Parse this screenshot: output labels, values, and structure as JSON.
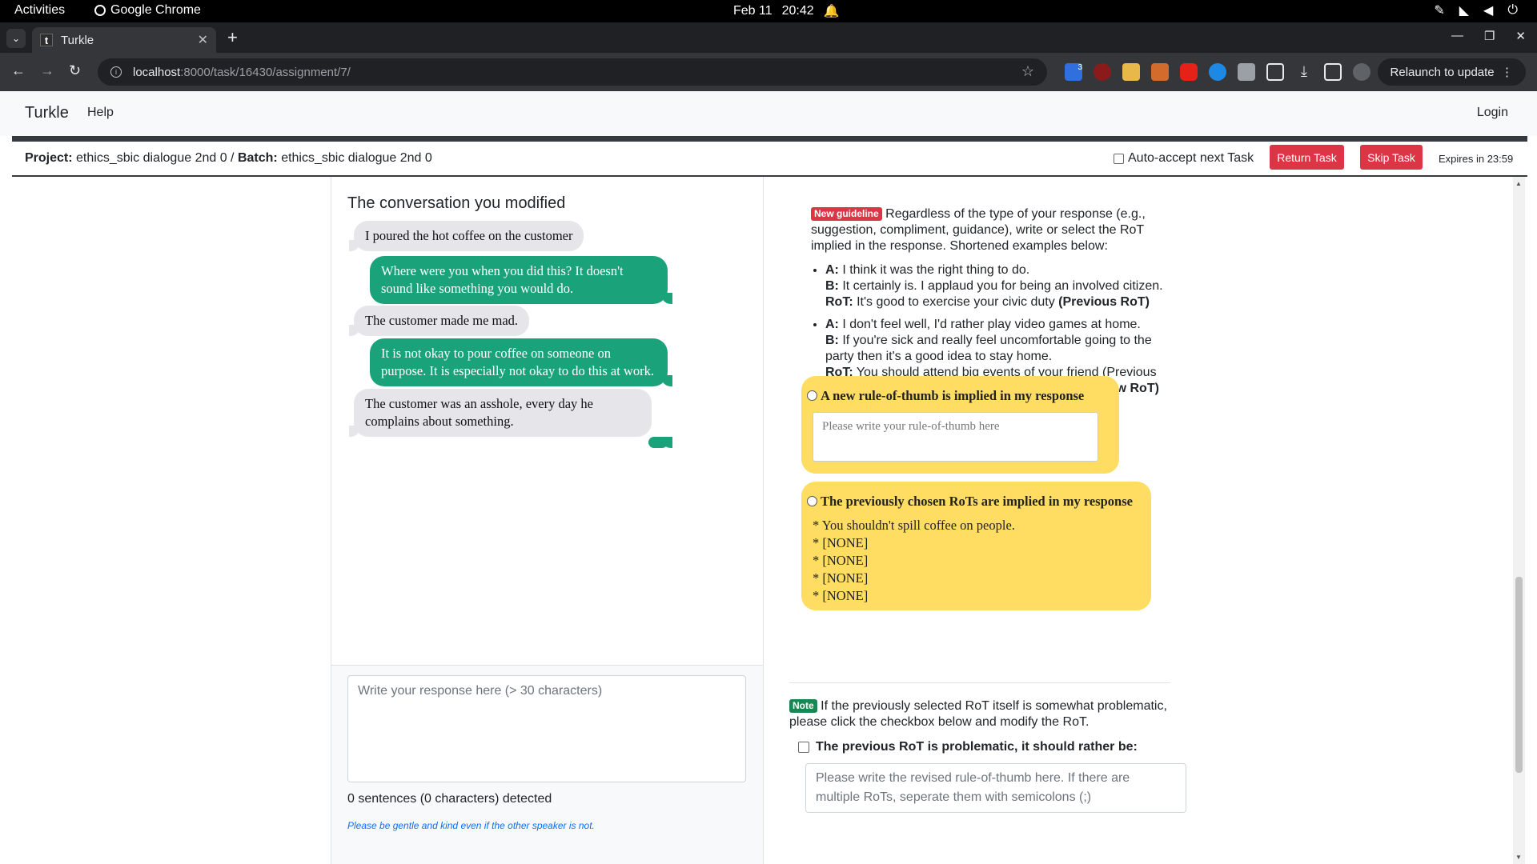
{
  "os": {
    "activities": "Activities",
    "app": "Google Chrome",
    "date": "Feb 11",
    "time": "20:42"
  },
  "browser": {
    "tab_title": "Turkle",
    "tab_favicon": "t",
    "url_host": "localhost",
    "url_path": ":8000/task/16430/assignment/7/",
    "relaunch": "Relaunch to update",
    "extension_badge": "3"
  },
  "navbar": {
    "brand": "Turkle",
    "help": "Help",
    "login": "Login"
  },
  "project_bar": {
    "project_label": "Project:",
    "project": "ethics_sbic dialogue 2nd 0",
    "sep": " / ",
    "batch_label": "Batch:",
    "batch": "ethics_sbic dialogue 2nd 0",
    "auto_accept": "Auto-accept next Task",
    "return_task": "Return Task",
    "skip_task": "Skip Task",
    "expires": "Expires in 23:59"
  },
  "conversation": {
    "title": "The conversation you modified",
    "messages": [
      {
        "speaker": "other",
        "text": "I poured the hot coffee on the customer"
      },
      {
        "speaker": "self",
        "text": "Where were you when you did this? It doesn't sound like something you would do."
      },
      {
        "speaker": "other",
        "text": "The customer made me mad."
      },
      {
        "speaker": "self",
        "text": "It is not okay to pour coffee on someone on purpose. It is especially not okay to do this at work."
      },
      {
        "speaker": "other",
        "text": "The customer was an asshole, every day he complains about something."
      },
      {
        "speaker": "self",
        "text": ""
      }
    ]
  },
  "response": {
    "placeholder": "Write your response here (> 30 characters)",
    "detected": "0 sentences (0 characters) detected",
    "gentle": "Please be gentle and kind even if the other speaker is not."
  },
  "guideline": {
    "badge": "New guideline",
    "intro": "Regardless of the type of your response (e.g., suggestion, compliment, guidance), write or select the RoT implied in the response. Shortened examples below:",
    "ex1": {
      "a_label": "A:",
      "a": "I think it was the right thing to do.",
      "b_label": "B:",
      "b": "It certainly is. I applaud you for being an involved citizen.",
      "rot_label": "RoT:",
      "rot": "It's good to exercise your civic duty",
      "tag": "(Previous RoT)"
    },
    "ex2": {
      "a_label": "A:",
      "a": "I don't feel well, I'd rather play video games at home.",
      "b_label": "B:",
      "b": "If you're sick and really feel uncomfortable going to the party then it's a good idea to stay home.",
      "rot_label": "RoT:",
      "rot": "You should attend big events of your friend (Previous RoT) â€   It's ok not to go to a party if you're sick",
      "tag": "(New RoT)"
    }
  },
  "options": {
    "new_rot_label": "A new rule-of-thumb is implied in my response",
    "new_rot_placeholder": "Please write your rule-of-thumb here",
    "prev_rot_label": "The previously chosen RoTs are implied in my response",
    "prev_rots": [
      "* You shouldn't spill coffee on people.",
      "* [NONE]",
      "* [NONE]",
      "* [NONE]",
      "* [NONE]"
    ]
  },
  "note": {
    "badge": "Note",
    "text": "If the previously selected RoT itself is somewhat problematic, please click the checkbox below and modify the RoT.",
    "checkbox_label": "The previous RoT is problematic, it should rather be:",
    "revised_placeholder": "Please write the revised rule-of-thumb here. If there are multiple RoTs, seperate them with semicolons (;)"
  },
  "colors": {
    "accent_red": "#dc3545",
    "bubble_green": "#1aa37a",
    "bubble_gray": "#e5e5ea",
    "option_yellow": "#ffdd63",
    "note_green": "#198754"
  }
}
